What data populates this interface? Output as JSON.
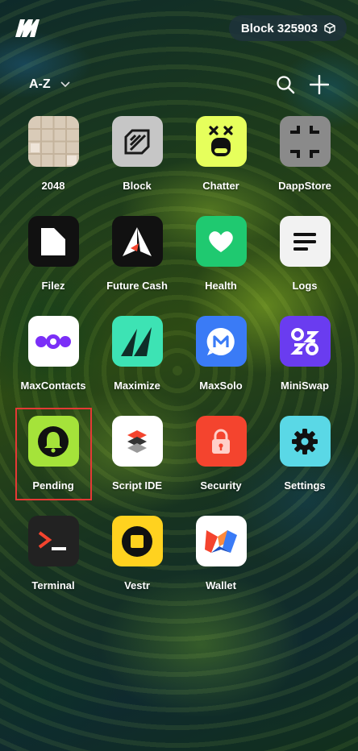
{
  "header": {
    "logo": "minima-logo",
    "block_label": "Block 325903",
    "block_icon": "cube-icon"
  },
  "toolbar": {
    "sort_label": "A-Z",
    "sort_icon": "chevron-down-icon",
    "search_icon": "search-icon",
    "add_icon": "plus-icon"
  },
  "apps": [
    {
      "label": "2048",
      "icon": "2048-icon",
      "bg": "#d9cbb8"
    },
    {
      "label": "Block",
      "icon": "block-icon",
      "bg": "#c6c6c6"
    },
    {
      "label": "Chatter",
      "icon": "chatter-icon",
      "bg": "#e6ff5c"
    },
    {
      "label": "DappStore",
      "icon": "dappstore-icon",
      "bg": "#8a8a8a"
    },
    {
      "label": "Filez",
      "icon": "filez-icon",
      "bg": "#111111"
    },
    {
      "label": "Future Cash",
      "icon": "future-cash-icon",
      "bg": "#111111"
    },
    {
      "label": "Health",
      "icon": "health-icon",
      "bg": "#1fc970"
    },
    {
      "label": "Logs",
      "icon": "logs-icon",
      "bg": "#f2f2f2"
    },
    {
      "label": "MaxContacts",
      "icon": "maxcontacts-icon",
      "bg": "#ffffff"
    },
    {
      "label": "Maximize",
      "icon": "maximize-icon",
      "bg": "#3de3b4"
    },
    {
      "label": "MaxSolo",
      "icon": "maxsolo-icon",
      "bg": "#3a7bf6"
    },
    {
      "label": "MiniSwap",
      "icon": "miniswap-icon",
      "bg": "#6a3cf0"
    },
    {
      "label": "Pending",
      "icon": "pending-icon",
      "bg": "#a5e33a",
      "selected": true
    },
    {
      "label": "Script IDE",
      "icon": "script-ide-icon",
      "bg": "#ffffff"
    },
    {
      "label": "Security",
      "icon": "security-icon",
      "bg": "#f4442e"
    },
    {
      "label": "Settings",
      "icon": "settings-icon",
      "bg": "#5ad8e6"
    },
    {
      "label": "Terminal",
      "icon": "terminal-icon",
      "bg": "#222222"
    },
    {
      "label": "Vestr",
      "icon": "vestr-icon",
      "bg": "#ffd21f"
    },
    {
      "label": "Wallet",
      "icon": "wallet-icon",
      "bg": "#ffffff"
    }
  ]
}
